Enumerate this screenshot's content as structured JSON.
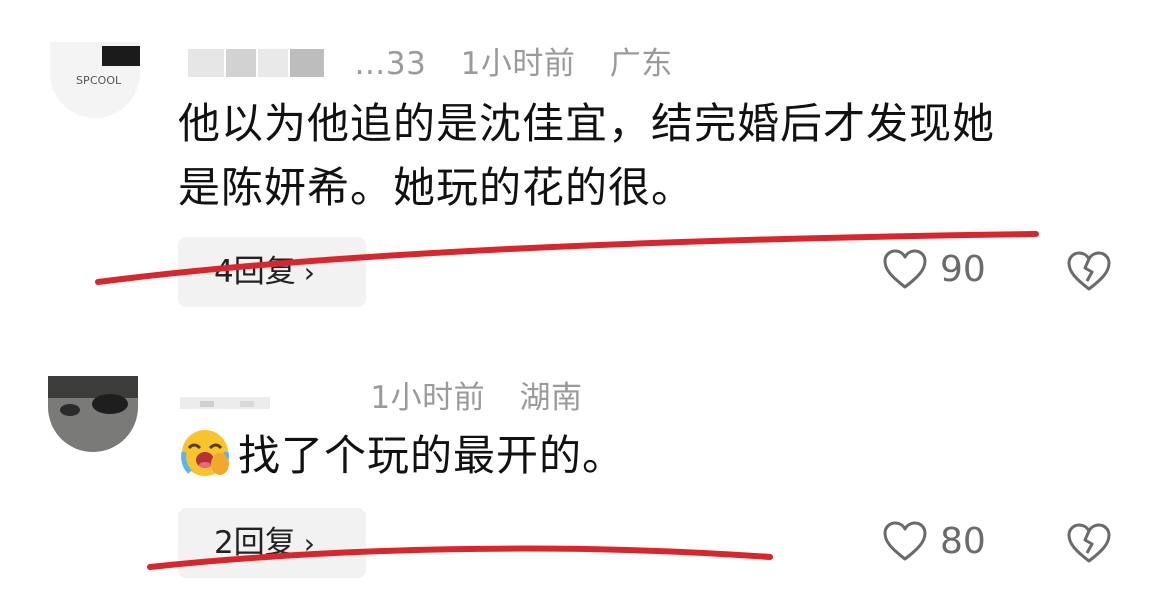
{
  "comments": [
    {
      "username": "…33",
      "time": "1小时前",
      "location": "广东",
      "text_line1": "他以为他追的是沈佳宜，结完婚后才发现她",
      "text_line2": "是陈妍希。她玩的花的很。",
      "reply_label": "4回复",
      "likes": "90"
    },
    {
      "username": "",
      "time": "1小时前",
      "location": "湖南",
      "emoji": "laughing-crying-emoji",
      "text": "找了个玩的最开的。",
      "reply_label": "2回复",
      "likes": "80"
    }
  ],
  "colors": {
    "annotation_red": "#d8262c",
    "meta_gray": "#9a9a9a",
    "button_bg": "#f2f2f2"
  }
}
